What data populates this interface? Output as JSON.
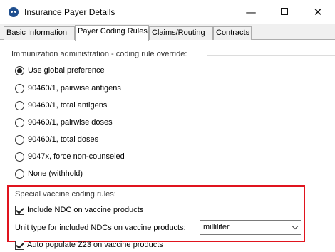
{
  "window": {
    "title": "Insurance Payer Details",
    "minimize_glyph": "—",
    "close_glyph": "✕"
  },
  "tabs": [
    {
      "label": "Basic Information",
      "active": false
    },
    {
      "label": "Payer Coding Rules",
      "active": true
    },
    {
      "label": "Claims/Routing",
      "active": false
    },
    {
      "label": "Contracts",
      "active": false
    }
  ],
  "immunization": {
    "legend": "Immunization administration - coding rule override:",
    "options": [
      {
        "label": "Use global preference",
        "selected": true
      },
      {
        "label": "90460/1, pairwise antigens",
        "selected": false
      },
      {
        "label": "90460/1, total antigens",
        "selected": false
      },
      {
        "label": "90460/1, pairwise doses",
        "selected": false
      },
      {
        "label": "90460/1, total doses",
        "selected": false
      },
      {
        "label": "9047x, force non-counseled",
        "selected": false
      },
      {
        "label": "None (withhold)",
        "selected": false
      }
    ]
  },
  "special": {
    "legend": "Special vaccine coding rules:",
    "include_ndc_label": "Include NDC on vaccine products",
    "include_ndc_checked": true,
    "unit_type_label": "Unit type for included NDCs on vaccine products:",
    "unit_type_value": "milliliter"
  },
  "auto_populate": {
    "label": "Auto populate Z23 on vaccine products",
    "checked": true
  },
  "colors": {
    "highlight": "#e0141e",
    "app_icon": "#1f4f8f"
  }
}
